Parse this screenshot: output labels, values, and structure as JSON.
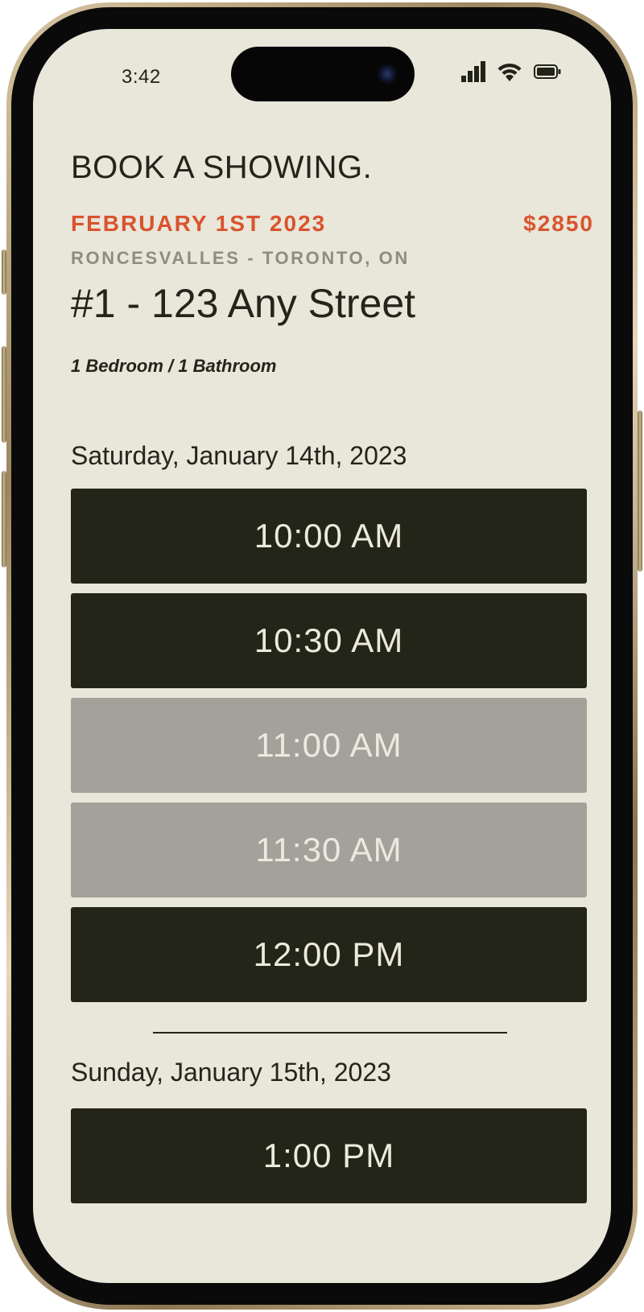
{
  "status_bar": {
    "time": "3:42"
  },
  "page": {
    "title": "BOOK A SHOWING.",
    "move_in_date": "FEBRUARY 1ST 2023",
    "price": "$2850",
    "neighbourhood": "RONCESVALLES - TORONTO, ON",
    "address": "#1 - 123 Any Street",
    "rooms": "1 Bedroom / 1 Bathroom"
  },
  "days": [
    {
      "date": "Saturday, January 14th, 2023",
      "slots": [
        {
          "time": "10:00 AM",
          "available": true
        },
        {
          "time": "10:30 AM",
          "available": true
        },
        {
          "time": "11:00 AM",
          "available": false
        },
        {
          "time": "11:30 AM",
          "available": false
        },
        {
          "time": "12:00 PM",
          "available": true
        }
      ]
    },
    {
      "date": "Sunday, January 15th, 2023",
      "slots": [
        {
          "time": "1:00 PM",
          "available": true
        }
      ]
    }
  ],
  "colors": {
    "background": "#e9e6da",
    "accent": "#d9532c",
    "available_slot": "#222517",
    "unavailable_slot": "#a3a29a",
    "text": "#23251a"
  },
  "icons": [
    "signal-icon",
    "wifi-icon",
    "battery-icon"
  ]
}
